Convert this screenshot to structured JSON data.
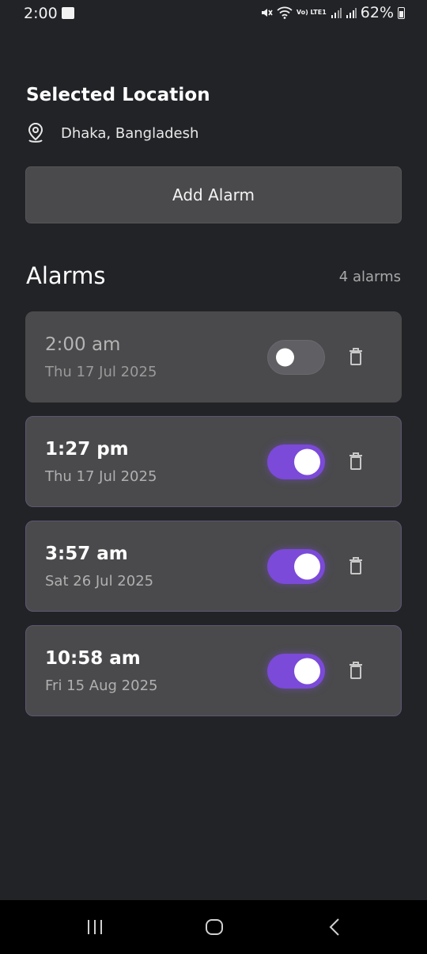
{
  "status_bar": {
    "time": "2:00",
    "lte_label": "Vo) LTE1",
    "battery": "62%"
  },
  "location": {
    "title": "Selected Location",
    "name": "Dhaka, Bangladesh",
    "icon": "location-pin-icon"
  },
  "add_alarm_label": "Add Alarm",
  "alarms": {
    "heading": "Alarms",
    "count_label": "4 alarms",
    "items": [
      {
        "time": "2:00 am",
        "date": "Thu 17 Jul 2025",
        "enabled": false
      },
      {
        "time": "1:27 pm",
        "date": "Thu 17 Jul 2025",
        "enabled": true
      },
      {
        "time": "3:57 am",
        "date": "Sat 26 Jul 2025",
        "enabled": true
      },
      {
        "time": "10:58 am",
        "date": "Fri 15 Aug 2025",
        "enabled": true
      }
    ]
  },
  "colors": {
    "background": "#222327",
    "card": "#4a4a4c",
    "accent": "#7b4ad8",
    "nav_bar": "#000000"
  },
  "nav_bar": {
    "recents_icon": "recents-icon",
    "home_icon": "home-icon",
    "back_icon": "back-icon"
  }
}
